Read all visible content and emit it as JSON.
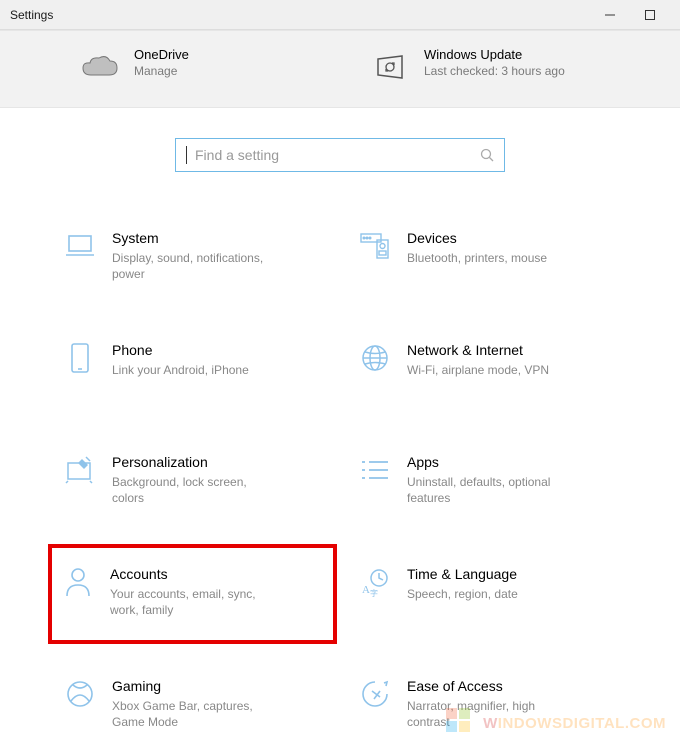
{
  "window": {
    "title": "Settings"
  },
  "header": {
    "onedrive": {
      "title": "OneDrive",
      "subtitle": "Manage"
    },
    "update": {
      "title": "Windows Update",
      "subtitle": "Last checked: 3 hours ago"
    }
  },
  "search": {
    "placeholder": "Find a setting"
  },
  "tiles": {
    "system": {
      "title": "System",
      "subtitle": "Display, sound, notifications, power"
    },
    "devices": {
      "title": "Devices",
      "subtitle": "Bluetooth, printers, mouse"
    },
    "phone": {
      "title": "Phone",
      "subtitle": "Link your Android, iPhone"
    },
    "network": {
      "title": "Network & Internet",
      "subtitle": "Wi-Fi, airplane mode, VPN"
    },
    "personalization": {
      "title": "Personalization",
      "subtitle": "Background, lock screen, colors"
    },
    "apps": {
      "title": "Apps",
      "subtitle": "Uninstall, defaults, optional features"
    },
    "accounts": {
      "title": "Accounts",
      "subtitle": "Your accounts, email, sync, work, family"
    },
    "time": {
      "title": "Time & Language",
      "subtitle": "Speech, region, date"
    },
    "gaming": {
      "title": "Gaming",
      "subtitle": "Xbox Game Bar, captures, Game Mode"
    },
    "ease": {
      "title": "Ease of Access",
      "subtitle": "Narrator, magnifier, high contrast"
    }
  },
  "highlighted_tile": "accounts",
  "watermark": {
    "w": "W",
    "rest": "INDOWSDIGITAL.COM"
  },
  "colors": {
    "icon_blue": "#8fc3ea",
    "border_blue": "#6fb9e6",
    "highlight_red": "#e40000"
  }
}
